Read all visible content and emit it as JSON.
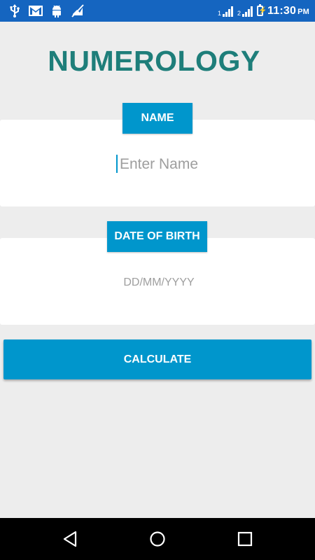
{
  "status_bar": {
    "time": "11:30",
    "ampm": "PM",
    "sim1": "1",
    "sim2": "2",
    "icons": [
      "usb-icon",
      "gmail-icon",
      "android-icon",
      "mute-icon"
    ]
  },
  "app": {
    "title": "NUMEROLOGY"
  },
  "name_section": {
    "label": "NAME",
    "placeholder": "Enter Name",
    "value": ""
  },
  "dob_section": {
    "label": "DATE OF BIRTH",
    "placeholder": "DD/MM/YYYY",
    "value": ""
  },
  "calculate_button": {
    "label": "CALCULATE"
  },
  "colors": {
    "accent": "#0096cc",
    "title": "#1e7e7a",
    "status_bar": "#1565c0",
    "background": "#ededed"
  }
}
